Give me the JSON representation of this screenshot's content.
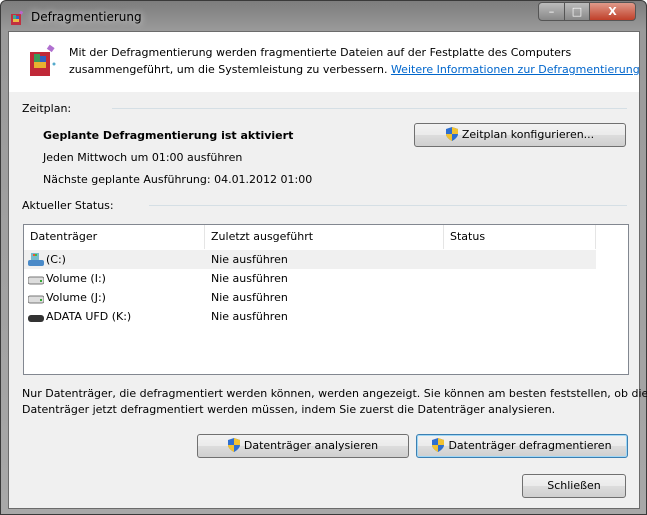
{
  "window": {
    "title": "Defragmentierung",
    "minimize": "–",
    "maximize": "□",
    "close": "X"
  },
  "intro": {
    "text_line1": "Mit der Defragmentierung werden fragmentierte Dateien auf der Festplatte des Computers",
    "text_line2": "zusammengeführt, um die Systemleistung zu verbessern.",
    "link": "Weitere Informationen zur Defragmentierung"
  },
  "schedule": {
    "heading": "Zeitplan:",
    "status": "Geplante Defragmentierung ist aktiviert",
    "when": "Jeden Mittwoch um 01:00 ausführen",
    "next": "Nächste geplante Ausführung: 04.01.2012 01:00",
    "configure_button": "Zeitplan konfigurieren..."
  },
  "current": {
    "heading": "Aktueller Status:",
    "columns": [
      "Datenträger",
      "Zuletzt ausgeführt",
      "Status"
    ],
    "rows": [
      {
        "drive": "(C:)",
        "last": "Nie ausführen",
        "status": "",
        "icon": "system-drive-icon"
      },
      {
        "drive": "Volume (I:)",
        "last": "Nie ausführen",
        "status": "",
        "icon": "hard-drive-icon"
      },
      {
        "drive": "Volume (J:)",
        "last": "Nie ausführen",
        "status": "",
        "icon": "hard-drive-icon"
      },
      {
        "drive": "ADATA UFD (K:)",
        "last": "Nie ausführen",
        "status": "",
        "icon": "usb-drive-icon"
      }
    ]
  },
  "note": {
    "line1": "Nur Datenträger, die defragmentiert werden können, werden angezeigt. Sie können am besten feststellen, ob die",
    "line2": "Datenträger jetzt defragmentiert werden müssen, indem Sie zuerst die Datenträger analysieren."
  },
  "buttons": {
    "analyze": "Datenträger analysieren",
    "defrag": "Datenträger defragmentieren",
    "close": "Schließen"
  }
}
